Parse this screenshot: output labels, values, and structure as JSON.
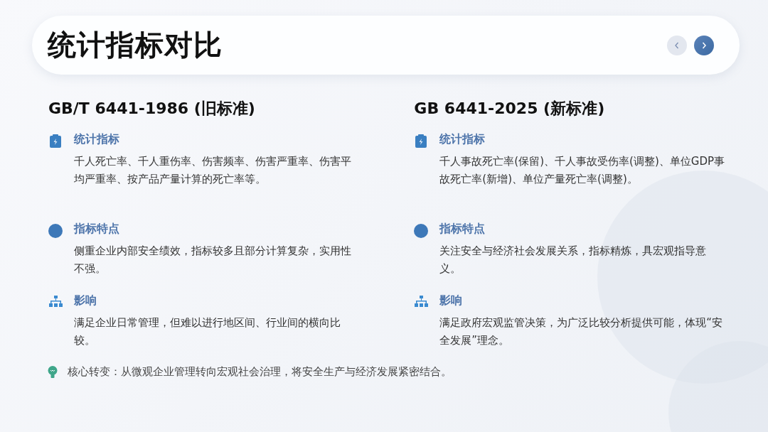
{
  "header": {
    "title": "统计指标对比"
  },
  "columns": [
    {
      "heading": "GB/T 6441-1986 (旧标准)",
      "sections": [
        {
          "title": "统计指标",
          "text": "千人死亡率、千人重伤率、伤害频率、伤害严重率、伤害平均严重率、按产品产量计算的死亡率等。"
        },
        {
          "title": "指标特点",
          "text": "侧重企业内部安全绩效，指标较多且部分计算复杂，实用性不强。"
        },
        {
          "title": "影响",
          "text": "满足企业日常管理，但难以进行地区间、行业间的横向比较。"
        }
      ]
    },
    {
      "heading": "GB 6441-2025 (新标准)",
      "sections": [
        {
          "title": "统计指标",
          "text": "千人事故死亡率(保留)、千人事故受伤率(调整)、单位GDP事故死亡率(新增)、单位产量死亡率(调整)。"
        },
        {
          "title": "指标特点",
          "text": "关注安全与经济社会发展关系，指标精炼，具宏观指导意义。"
        },
        {
          "title": "影响",
          "text": "满足政府宏观监管决策，为广泛比较分析提供可能，体现“安全发展”理念。"
        }
      ]
    }
  ],
  "footer": {
    "text": "核心转变：从微观企业管理转向宏观社会治理，将安全生产与经济发展紧密结合。"
  }
}
